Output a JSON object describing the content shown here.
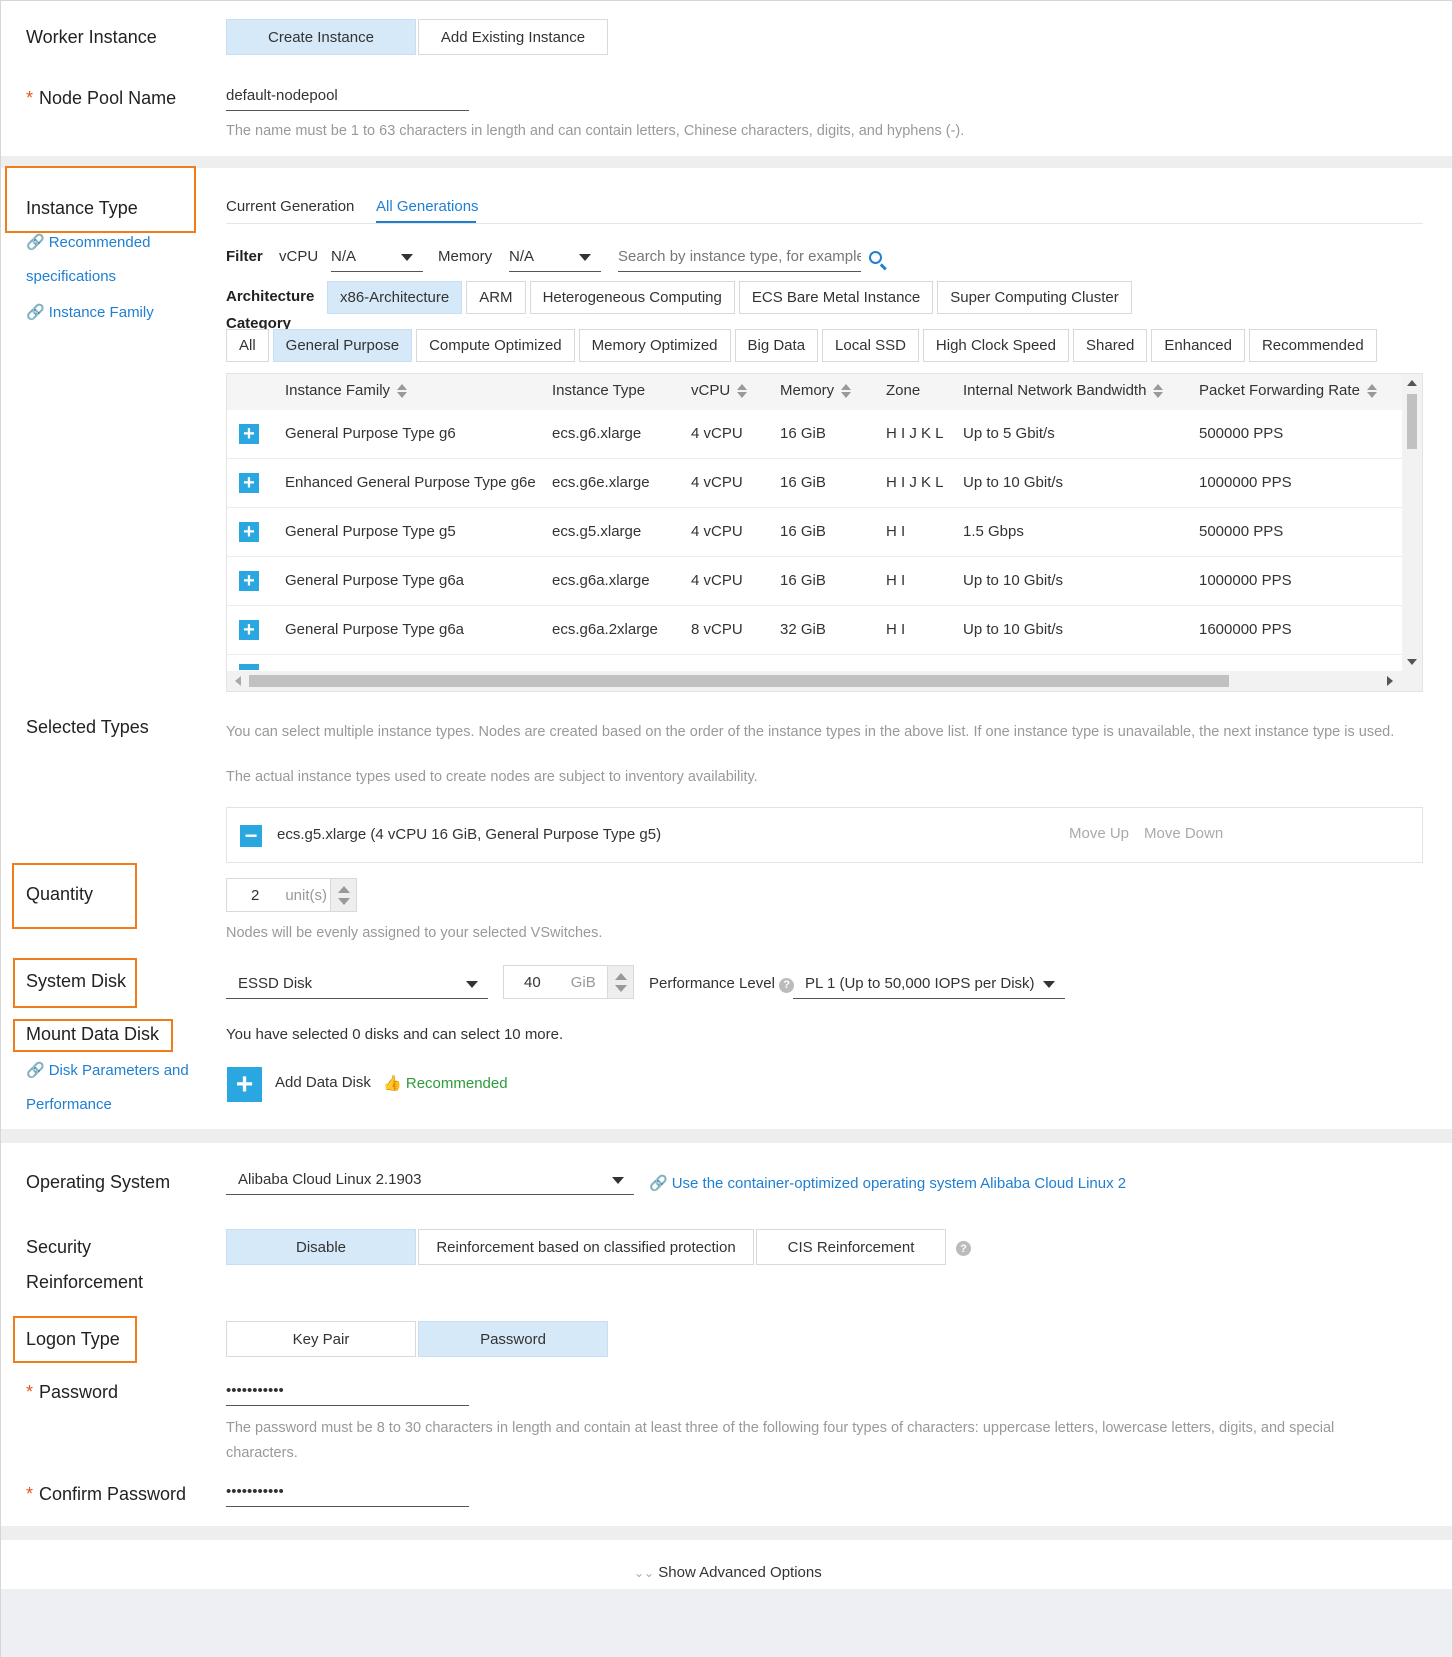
{
  "worker_instance": {
    "label": "Worker Instance",
    "options": [
      "Create Instance",
      "Add Existing Instance"
    ],
    "active_index": 0
  },
  "node_pool": {
    "label": "Node Pool Name",
    "required_mark": "*",
    "value": "default-nodepool",
    "hint": "The name must be 1 to 63 characters in length and can contain letters, Chinese characters, digits, and hyphens (-)."
  },
  "instance_type": {
    "label": "Instance Type",
    "links": [
      "Recommended",
      "specifications",
      "Instance Family"
    ],
    "tabs": [
      "Current Generation",
      "All Generations"
    ],
    "active_tab": 1,
    "filter": {
      "label": "Filter",
      "vcpu_label": "vCPU",
      "vcpu_value": "N/A",
      "memory_label": "Memory",
      "memory_value": "N/A",
      "search_placeholder": "Search by instance type, for example,"
    },
    "architecture": {
      "label": "Architecture",
      "options": [
        "x86-Architecture",
        "ARM",
        "Heterogeneous Computing",
        "ECS Bare Metal Instance",
        "Super Computing Cluster"
      ],
      "active_index": 0
    },
    "category": {
      "label": "Category",
      "options": [
        "All",
        "General Purpose",
        "Compute Optimized",
        "Memory Optimized",
        "Big Data",
        "Local SSD",
        "High Clock Speed",
        "Shared",
        "Enhanced",
        "Recommended"
      ],
      "active_index": 1
    },
    "table": {
      "headers": [
        "Instance Family",
        "Instance Type",
        "vCPU",
        "Memory",
        "Zone",
        "Internal Network Bandwidth",
        "Packet Forwarding Rate"
      ],
      "rows": [
        [
          "General Purpose Type g6",
          "ecs.g6.xlarge",
          "4 vCPU",
          "16 GiB",
          "H I J K L",
          "Up to 5 Gbit/s",
          "500000 PPS"
        ],
        [
          "Enhanced General Purpose Type g6e",
          "ecs.g6e.xlarge",
          "4 vCPU",
          "16 GiB",
          "H I J K L",
          "Up to 10 Gbit/s",
          "1000000 PPS"
        ],
        [
          "General Purpose Type g5",
          "ecs.g5.xlarge",
          "4 vCPU",
          "16 GiB",
          "H I",
          "1.5 Gbps",
          "500000 PPS"
        ],
        [
          "General Purpose Type g6a",
          "ecs.g6a.xlarge",
          "4 vCPU",
          "16 GiB",
          "H I",
          "Up to 10 Gbit/s",
          "1000000 PPS"
        ],
        [
          "General Purpose Type g6a",
          "ecs.g6a.2xlarge",
          "8 vCPU",
          "32 GiB",
          "H I",
          "Up to 10 Gbit/s",
          "1600000 PPS"
        ]
      ]
    }
  },
  "selected_types": {
    "label": "Selected Types",
    "hint1": "You can select multiple instance types. Nodes are created based on the order of the instance types in the above list. If one instance type is unavailable, the next instance type is used.",
    "hint2": "The actual instance types used to create nodes are subject to inventory availability.",
    "item": "ecs.g5.xlarge (4 vCPU 16 GiB, General Purpose Type g5)",
    "move_up": "Move Up",
    "move_down": "Move Down"
  },
  "quantity": {
    "label": "Quantity",
    "value": "2",
    "unit": "unit(s)",
    "hint": "Nodes will be evenly assigned to your selected VSwitches."
  },
  "system_disk": {
    "label": "System Disk",
    "type": "ESSD Disk",
    "size": "40",
    "unit": "GiB",
    "perf_label": "Performance Level",
    "perf_value": "PL 1 (Up to 50,000 IOPS per Disk)"
  },
  "data_disk": {
    "label": "Mount Data Disk",
    "links": [
      "Disk Parameters and",
      "Performance"
    ],
    "summary": "You have selected 0 disks and can select 10 more.",
    "add_label": "Add Data Disk",
    "recommended": "Recommended"
  },
  "os": {
    "label": "Operating System",
    "value": "Alibaba Cloud Linux 2.1903",
    "link": "Use the container-optimized operating system Alibaba Cloud Linux 2"
  },
  "security": {
    "label1": "Security",
    "label2": "Reinforcement",
    "options": [
      "Disable",
      "Reinforcement based on classified protection",
      "CIS Reinforcement"
    ],
    "active_index": 0
  },
  "logon": {
    "label": "Logon Type",
    "options": [
      "Key Pair",
      "Password"
    ],
    "active_index": 1
  },
  "password": {
    "label": "Password",
    "value": "•••••••••••",
    "hint1": "The password must be 8 to 30 characters in length and contain at least three of the following four types of characters: uppercase letters, lowercase letters, digits, and special",
    "hint2": "characters."
  },
  "confirm_password": {
    "label": "Confirm Password",
    "value": "•••••••••••"
  },
  "advanced": {
    "label": "Show Advanced Options"
  },
  "colors": {
    "highlight": "#f07d1c",
    "link": "#1f7fd1",
    "active_bg": "#d6e9f8",
    "plus_btn": "#2aa7e0",
    "required": "#e8541e"
  }
}
